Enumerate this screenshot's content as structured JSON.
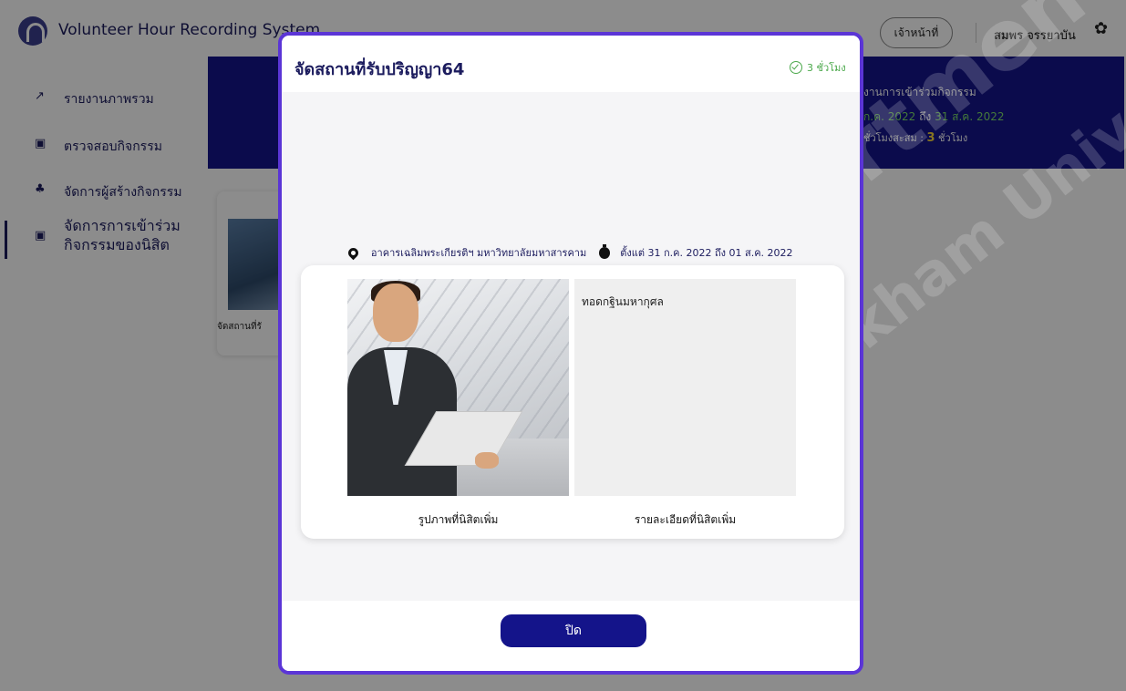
{
  "app": {
    "title": "Volunteer Hour Recording System",
    "role_button": "เจ้าหน้าที่",
    "user_name": "สมพร จรรยาบัน"
  },
  "sidebar": {
    "items": [
      {
        "label": "รายงานภาพรวม",
        "icon": "trend-icon"
      },
      {
        "label": "ตรวจสอบกิจกรรม",
        "icon": "ticket-icon"
      },
      {
        "label": "จัดการผู้สร้างกิจกรรม",
        "icon": "users-icon"
      },
      {
        "label": "จัดการการเข้าร่วมกิจกรรมของนิสิต",
        "icon": "ticket-icon",
        "active": true
      }
    ]
  },
  "banner": {
    "title": "งานการเข้าร่วมกิจกรรม",
    "date_from": "ก.ค. 2022",
    "date_sep": "ถึง",
    "date_to": "31 ส.ค. 2022",
    "hours_label": "ชั่วโมงสะสม :",
    "hours_value": "3",
    "hours_unit": "ชั่วโมง"
  },
  "background_card": {
    "label": "จัดสถานที่รั"
  },
  "modal": {
    "title": "จัดสถานที่รับปริญญา64",
    "hours_badge": "3 ชั่วโมง",
    "location": "อาคารเฉลิมพระเกียรติฯ มหาวิทยาลัยมหาสารคาม",
    "date_range": "ตั้งแต่ 31 ก.ค. 2022 ถึง 01 ส.ค. 2022",
    "detail_text": "ทอดกฐินมหากุศล",
    "photo_caption": "รูปภาพที่นิสิตเพิ่ม",
    "detail_caption": "รายละเอียดที่นิสิตเพิ่ม",
    "close_label": "ปิด"
  },
  "watermark": {
    "line1": "CS Department",
    "line2": "Mahasarakham University"
  },
  "colors": {
    "primary": "#14148a",
    "modal_border": "#5b35d6",
    "accent_green": "#4aa84a",
    "highlight_yellow": "#f6d33c"
  }
}
